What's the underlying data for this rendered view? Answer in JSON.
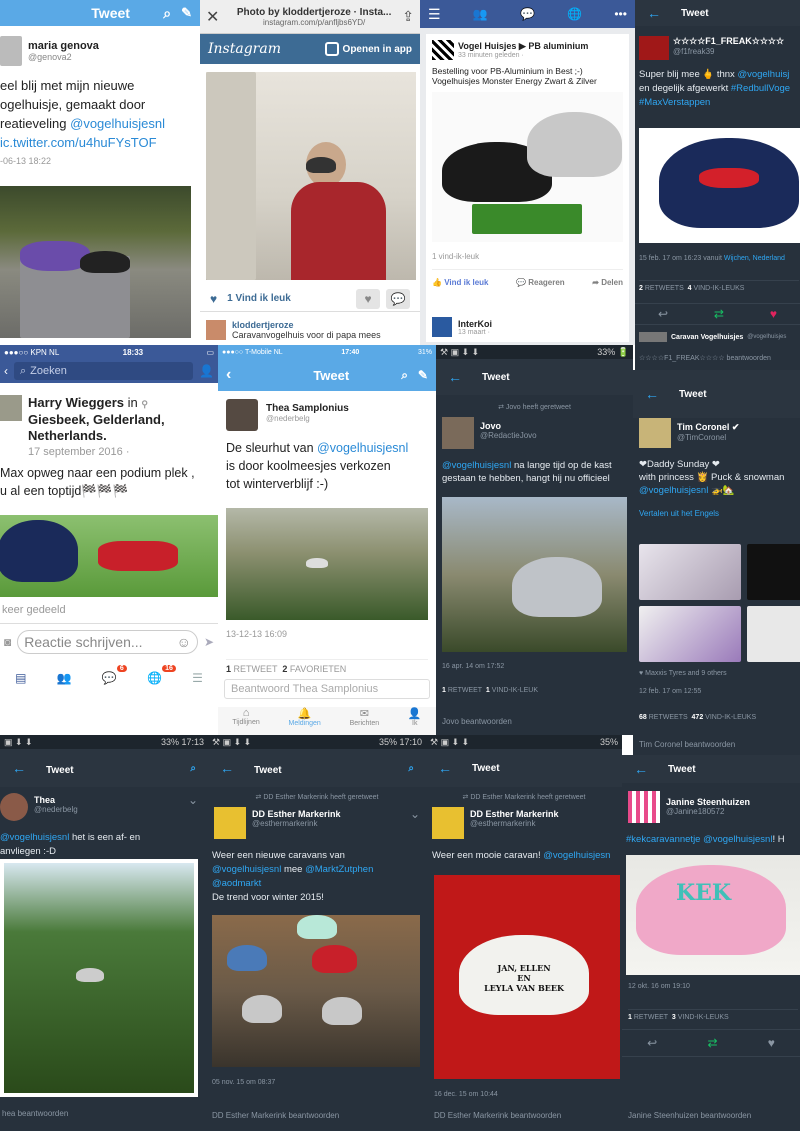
{
  "p1": {
    "title": "Tweet",
    "name": "maria genova",
    "handle": "@genova2",
    "text_a": "eel blij met mijn nieuwe",
    "text_b": "ogelhuisje, gemaakt door",
    "text_c": "reatieveling",
    "mention": "@vogelhuisjesnl",
    "link": "ic.twitter.com/u4huFYsTOF",
    "date": "-06-13 18:22"
  },
  "p2": {
    "title": "Photo by kloddertjeroze · Insta...",
    "url": "instagram.com/p/anfljbs6YD/",
    "brand": "Instagram",
    "open": "Openen in app",
    "likes": "1 Vind ik leuk",
    "user": "kloddertjeroze",
    "caption": "Caravanvogelhuis voor di papa mees"
  },
  "p3": {
    "page": "Vogel Huisjes",
    "page2": "PB aluminium",
    "time": "33 minuten geleden ·",
    "text1": "Bestelling voor PB-Aluminium in Best ;-)",
    "text2": "Vogelhuisjes Monster Energy Zwart & Zilver",
    "likes": "1 vind-ik-leuk",
    "like_btn": "Vind ik leuk",
    "reply_btn": "Reageren",
    "share_btn": "Delen",
    "next_name": "InterKoi",
    "next_time": "13 maart ·"
  },
  "p4": {
    "title": "Tweet",
    "name": "☆☆☆☆F1_FREAK☆☆☆☆",
    "handle": "@f1freak39",
    "text_a": "Super blij mee 🖕 thnx",
    "mention": "@vogelhuisj",
    "text_b": "en degelijk afgewerkt",
    "tag1": "#RedbullVoge",
    "tag2": "#MaxVerstappen",
    "meta_a": "15 feb. 17 om 16:23 vanuit",
    "meta_loc": "Wijchen, Nederland",
    "rt": "2",
    "rt_l": "RETWEETS",
    "fav": "4",
    "fav_l": "VIND-IK-LEUKS",
    "next_name": "Caravan Vogelhuisjes",
    "next_handle": "@vogelhuisjes",
    "reply_l": "☆☆☆☆F1_FREAK☆☆☆☆ beantwoorden"
  },
  "p5": {
    "carrier": "●●●○○ KPN NL",
    "time": "18:33",
    "search": "Zoeken",
    "name": "Harry Wieggers",
    "in": "in",
    "place": "Giesbeek, Gelderland, Netherlands.",
    "date": "17 september 2016 ·",
    "text_a": "Max opweg naar een podium plek ,",
    "text_b": "u al een toptijd🏁🏁🏁",
    "shared": "keer gedeeld",
    "comment": "Reactie schrijven...",
    "badge1": "6",
    "badge2": "16"
  },
  "p6": {
    "carrier": "●●●○○ T-Mobile NL",
    "time": "17:40",
    "battery": "31%",
    "title": "Tweet",
    "name": "Thea Samplonius",
    "handle": "@nederbelg",
    "text_a": "De sleurhut van",
    "mention": "@vogelhuisjesnl",
    "text_b": "is door koolmeesjes verkozen",
    "text_c": "tot winterverblijf :-)",
    "date": "13-12-13 16:09",
    "rt": "1",
    "rt_l": "RETWEET",
    "fav": "2",
    "fav_l": "FAVORIETEN",
    "reply": "Beantwoord Thea Samplonius",
    "tabs": [
      "Tijdlijnen",
      "Meldingen",
      "Berichten",
      "Ik"
    ]
  },
  "p7": {
    "status": "33% 🔋",
    "title": "Tweet",
    "retweeted": "Jovo heeft geretweet",
    "name": "Jovo",
    "handle": "@RedactieJovo",
    "mention": "@vogelhuisjesnl",
    "text": "na lange tijd op de kast gestaan te hebben, hangt hij nu officieel",
    "date": "16 apr. 14 om 17:52",
    "rt": "1",
    "rt_l": "RETWEET",
    "fav": "1",
    "fav_l": "VIND-IK-LEUK",
    "reply": "Jovo beantwoorden"
  },
  "p8": {
    "title": "Tweet",
    "name": "Tim Coronel",
    "handle": "@TimCoronel",
    "text_a": "❤Daddy Sunday ❤",
    "text_b": "with princess 👸 Puck & snowman",
    "mention": "@vogelhuisjesnl",
    "translate": "Vertalen uit het Engels",
    "liked": "Maxxis Tyres and 9 others",
    "date": "12 feb. 17 om 12:55",
    "rt": "68",
    "rt_l": "RETWEETS",
    "fav": "472",
    "fav_l": "VIND-IK-LEUKS",
    "reply": "Tim Coronel beantwoorden"
  },
  "p9": {
    "status": "33% 17:13",
    "title": "Tweet",
    "name": "Thea",
    "handle": "@nederbelg",
    "mention": "@vogelhuisjesnl",
    "text_a": "het is een af- en",
    "text_b": "anvliegen :-D",
    "reply": "hea beantwoorden"
  },
  "p10": {
    "status": "35% 17:10",
    "title": "Tweet",
    "retweeted": "DD Esther Markerink heeft geretweet",
    "name": "DD Esther Markerink",
    "handle": "@esthermarkerink",
    "text_a": "Weer een nieuwe caravans van",
    "m1": "@vogelhuisjesnl",
    "text_b": "mee",
    "m2": "@MarktZutphen",
    "m3": "@aodmarkt",
    "text_c": "De trend voor winter 2015!",
    "date": "05 nov. 15 om 08:37",
    "reply": "DD Esther Markerink beantwoorden"
  },
  "p11": {
    "status": "35%",
    "title": "Tweet",
    "retweeted": "DD Esther Markerink heeft geretweet",
    "name": "DD Esther Markerink",
    "handle": "@esthermarkerink",
    "text": "Weer een mooie caravan!",
    "mention": "@vogelhuisjesn",
    "plate_a": "JAN, ELLEN",
    "plate_b": "EN",
    "plate_c": "LEYLA VAN BEEK",
    "date": "16 dec. 15 om 10:44",
    "reply": "DD Esther Markerink beantwoorden"
  },
  "p12": {
    "title": "Tweet",
    "name": "Janine Steenhuizen",
    "handle": "@Janine180572",
    "tag": "#kekcaravannetje",
    "mention": "@vogelhuisjesnl",
    "tail": "! H",
    "kek": "KEK",
    "date": "12 okt. 16 om 19:10",
    "rt": "1",
    "rt_l": "RETWEET",
    "fav": "3",
    "fav_l": "VIND-IK-LEUKS",
    "reply": "Janine Steenhuizen beantwoorden"
  },
  "colors": {
    "twitter_blue": "#5aa9e6",
    "dark_bg": "#27313c",
    "link": "#2fa7f3",
    "fb_blue": "#3b5998",
    "like_pink": "#e0245e",
    "rt_green": "#17bf63"
  }
}
